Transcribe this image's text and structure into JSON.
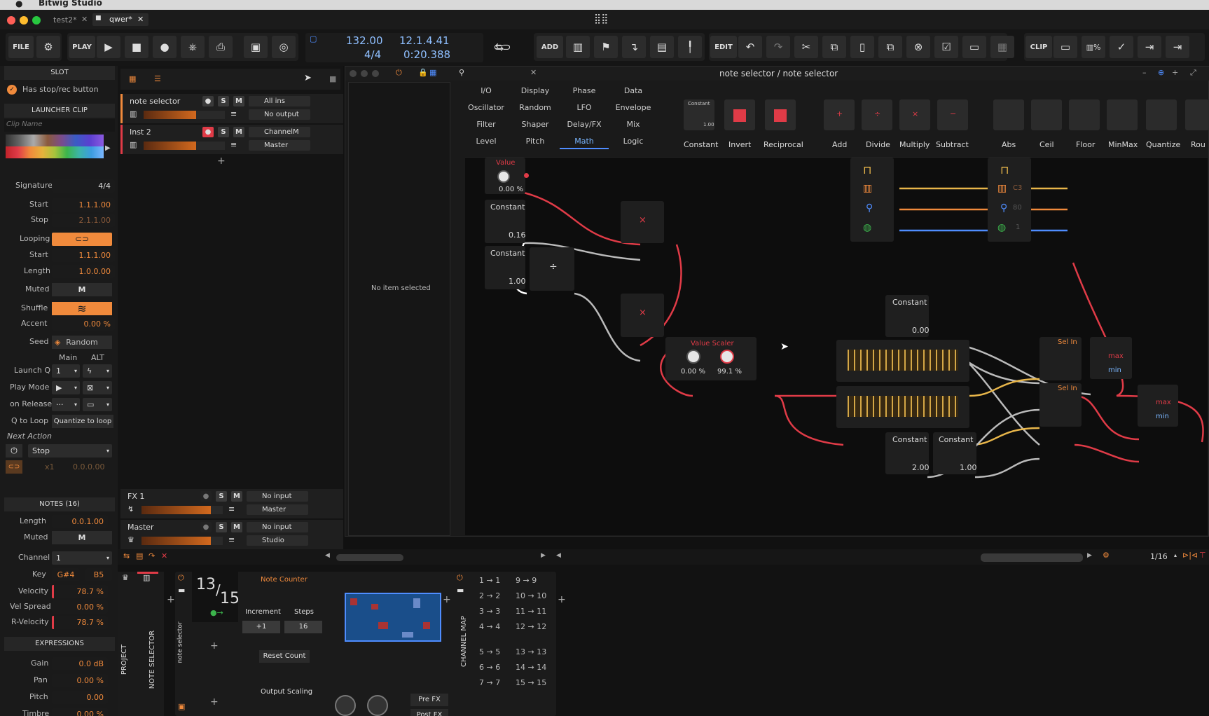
{
  "os": {
    "app_name": "Bitwig Studio"
  },
  "tabs": [
    {
      "label": "test2*"
    },
    {
      "label": "qwer*"
    }
  ],
  "toolbar": {
    "file": "FILE",
    "play": "PLAY",
    "add": "ADD",
    "edit": "EDIT",
    "clip": "CLIP",
    "tempo": "132.00",
    "signature": "4/4",
    "position": "12.1.4.41",
    "time": "0:20.388"
  },
  "inspector": {
    "slot_header": "SLOT",
    "stop_rec": "Has stop/rec button",
    "launcher_clip": "LAUNCHER CLIP",
    "clip_name_placeholder": "Clip Name",
    "signature_label": "Signature",
    "signature": "4/4",
    "start_label": "Start",
    "start": "1.1.1.00",
    "stop_label": "Stop",
    "stop": "2.1.1.00",
    "looping_label": "Looping",
    "loop_start_label": "Start",
    "loop_start": "1.1.1.00",
    "length_label": "Length",
    "length": "1.0.0.00",
    "muted_label": "Muted",
    "muted_btn": "M",
    "shuffle_label": "Shuffle",
    "accent_label": "Accent",
    "accent": "0.00 %",
    "seed_label": "Seed",
    "seed": "Random",
    "main_label": "Main",
    "alt_label": "ALT",
    "launchq_label": "Launch Q",
    "launchq": "1",
    "playmode_label": "Play Mode",
    "onrelease_label": "on Release",
    "qloop_label": "Q to Loop",
    "qloop": "Quantize to loop",
    "next_action_label": "Next Action",
    "next_action": "Stop",
    "x1": "x1",
    "next_pos": "0.0.0.00",
    "notes_header": "NOTES (16)",
    "notes_length_label": "Length",
    "notes_length": "0.0.1.00",
    "notes_muted_label": "Muted",
    "channel_label": "Channel",
    "channel": "1",
    "key_label": "Key",
    "key_low": "G#4",
    "key_high": "B5",
    "velocity_label": "Velocity",
    "velocity": "78.7 %",
    "velspread_label": "Vel Spread",
    "velspread": "0.00 %",
    "rvel_label": "R-Velocity",
    "rvel": "78.7 %",
    "expr_header": "EXPRESSIONS",
    "gain_label": "Gain",
    "gain": "0.0 dB",
    "pan_label": "Pan",
    "pan": "0.00 %",
    "pitch_label": "Pitch",
    "pitch": "0.00",
    "timbre_label": "Timbre",
    "timbre": "0.00 %"
  },
  "tracks": [
    {
      "name": "note selector",
      "input": "All ins",
      "output": "No output"
    },
    {
      "name": "Inst 2",
      "input": "ChannelM",
      "output": "Master"
    }
  ],
  "fx_tracks": [
    {
      "name": "FX 1",
      "input": "No input",
      "output": "Master"
    },
    {
      "name": "Master",
      "input": "No input",
      "output": "Studio"
    }
  ],
  "browser": {
    "empty": "No item selected"
  },
  "grid": {
    "title": "note selector / note selector",
    "categories": [
      [
        "I/O",
        "Display",
        "Phase",
        "Data"
      ],
      [
        "Oscillator",
        "Random",
        "LFO",
        "Envelope"
      ],
      [
        "Filter",
        "Shaper",
        "Delay/FX",
        "Mix"
      ],
      [
        "Level",
        "Pitch",
        "Math",
        "Logic"
      ]
    ],
    "active_category": "Math",
    "modules": [
      "Constant",
      "Invert",
      "Reciprocal",
      "Add",
      "Divide",
      "Multiply",
      "Subtract",
      "Abs",
      "Ceil",
      "Floor",
      "MinMax",
      "Quantize",
      "Rou"
    ],
    "nodes": {
      "value_label": "Value",
      "value": "0.00 %",
      "const1_label": "Constant",
      "const1": "0.16",
      "const2_label": "Constant",
      "const2": "1.00",
      "scaler_label": "Value Scaler",
      "scaler_min": "0.00 %",
      "scaler_max": "99.1 %",
      "const3_label": "Constant",
      "const3": "0.00",
      "const4_label": "Constant",
      "const4": "2.00",
      "const5_label": "Constant",
      "const5": "1.00",
      "selin1": "Sel In",
      "selin2": "Sel In",
      "max1": "max",
      "min1": "min",
      "max2": "max",
      "min2": "min",
      "note_c3": "C3",
      "vel": "80",
      "ch": "1"
    }
  },
  "bottom": {
    "quantize": "1/16",
    "project": "PROJECT",
    "note_selector": "NOTE SELECTOR",
    "ns_small": "note selector",
    "counter_num": "13",
    "counter_den": "15",
    "note_counter": "Note Counter",
    "increment_label": "Increment",
    "steps_label": "Steps",
    "increment": "+1",
    "steps": "16",
    "reset": "Reset Count",
    "output_scaling": "Output Scaling",
    "prefx": "Pre FX",
    "postfx": "Post FX",
    "channel_map": "CHANNEL MAP",
    "map_left": [
      "1 → 1",
      "2 → 2",
      "3 → 3",
      "4 → 4",
      "5 → 5",
      "6 → 6",
      "7 → 7"
    ],
    "map_right": [
      "9 → 9",
      "10 → 10",
      "11 → 11",
      "12 → 12",
      "13 → 13",
      "14 → 14",
      "15 → 15"
    ]
  },
  "colors": {
    "accent": "#f08a3c",
    "red": "#e03b47",
    "blue": "#4f8dff",
    "bg": "#111111"
  }
}
